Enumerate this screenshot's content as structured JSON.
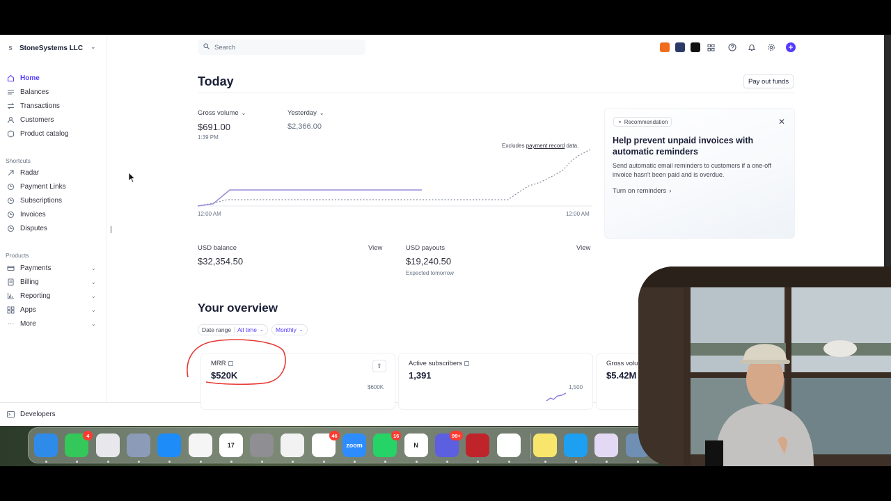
{
  "account": {
    "initial": "S",
    "name": "StoneSystems LLC"
  },
  "nav": {
    "main": [
      {
        "label": "Home",
        "icon": "home-icon",
        "active": true
      },
      {
        "label": "Balances",
        "icon": "balances-icon"
      },
      {
        "label": "Transactions",
        "icon": "transactions-icon"
      },
      {
        "label": "Customers",
        "icon": "customers-icon"
      },
      {
        "label": "Product catalog",
        "icon": "product-catalog-icon"
      }
    ],
    "shortcuts_label": "Shortcuts",
    "shortcuts": [
      {
        "label": "Radar",
        "icon": "radar-icon"
      },
      {
        "label": "Payment Links",
        "icon": "clock-icon"
      },
      {
        "label": "Subscriptions",
        "icon": "clock-icon"
      },
      {
        "label": "Invoices",
        "icon": "clock-icon"
      },
      {
        "label": "Disputes",
        "icon": "clock-icon"
      }
    ],
    "products_label": "Products",
    "products": [
      {
        "label": "Payments",
        "icon": "payments-icon"
      },
      {
        "label": "Billing",
        "icon": "billing-icon"
      },
      {
        "label": "Reporting",
        "icon": "reporting-icon"
      },
      {
        "label": "Apps",
        "icon": "apps-icon"
      },
      {
        "label": "More",
        "icon": "more-icon"
      }
    ],
    "developers": "Developers"
  },
  "search": {
    "placeholder": "Search"
  },
  "today": {
    "title": "Today",
    "payout_button": "Pay out funds",
    "gross_volume_label": "Gross volume",
    "gross_volume_value": "$691.00",
    "gross_volume_time": "1:39 PM",
    "compare_label": "Yesterday",
    "compare_value": "$2,366.00",
    "note_prefix": "Excludes ",
    "note_link": "payment record",
    "note_suffix": " data.",
    "axis_start": "12:00 AM",
    "axis_end": "12:00 AM",
    "usd_balance_label": "USD balance",
    "usd_balance_value": "$32,354.50",
    "usd_payouts_label": "USD payouts",
    "usd_payouts_value": "$19,240.50",
    "usd_payouts_sub": "Expected tomorrow",
    "view_label": "View"
  },
  "recommendation": {
    "tag": "Recommendation",
    "title": "Help prevent unpaid invoices with automatic reminders",
    "body": "Send automatic email reminders to customers if a one-off invoice hasn't been paid and is overdue.",
    "link": "Turn on reminders"
  },
  "overview": {
    "title": "Your overview",
    "date_range_label": "Date range",
    "date_range_value": "All time",
    "interval_value": "Monthly",
    "cards": [
      {
        "title": "MRR",
        "value": "$520K",
        "axis": "$600K"
      },
      {
        "title": "Active subscribers",
        "value": "1,391",
        "axis": "1,500"
      },
      {
        "title": "Gross volu",
        "value": "$5.42M",
        "axis": ""
      }
    ]
  },
  "dock": [
    {
      "name": "finder-icon",
      "label": "",
      "color": "#2f8bea"
    },
    {
      "name": "messages-icon",
      "label": "",
      "color": "#34c759",
      "badge": "4"
    },
    {
      "name": "launchpad-icon",
      "label": "",
      "color": "#e8e8ec"
    },
    {
      "name": "simulator-icon",
      "label": "",
      "color": "#8b9bb8"
    },
    {
      "name": "app-store-icon",
      "label": "",
      "color": "#1d8cf8"
    },
    {
      "name": "photos-icon",
      "label": "",
      "color": "#f5f5f5"
    },
    {
      "name": "calendar-icon",
      "label": "17",
      "color": "#ffffff"
    },
    {
      "name": "system-settings-icon",
      "label": "",
      "color": "#8e8e93"
    },
    {
      "name": "chrome-icon",
      "label": "",
      "color": "#f2f2f2"
    },
    {
      "name": "slack-icon",
      "label": "",
      "color": "#ffffff",
      "badge": "46"
    },
    {
      "name": "zoom-icon",
      "label": "zoom",
      "color": "#2d8cff"
    },
    {
      "name": "whatsapp-icon",
      "label": "",
      "color": "#25d366",
      "badge": "16"
    },
    {
      "name": "notion-icon",
      "label": "N",
      "color": "#ffffff"
    },
    {
      "name": "tasks-icon",
      "label": "",
      "color": "#5b5fe0",
      "badge": "99+"
    },
    {
      "name": "database-icon",
      "label": "",
      "color": "#c0242b"
    },
    {
      "name": "chatgpt-icon",
      "label": "",
      "color": "#ffffff"
    },
    {
      "name": "notes-icon",
      "label": "",
      "color": "#f8e56b"
    },
    {
      "name": "quicktime-icon",
      "label": "",
      "color": "#1ea0f2"
    },
    {
      "name": "screen-recorder-icon",
      "label": "",
      "color": "#e4d9f5"
    },
    {
      "name": "preview-icon",
      "label": "",
      "color": "#6f8fb4"
    }
  ],
  "colors": {
    "accent": "#533afd",
    "today_line": "#9b8cdb",
    "yesterday_line": "#8792a2",
    "annotation": "#e53935"
  }
}
